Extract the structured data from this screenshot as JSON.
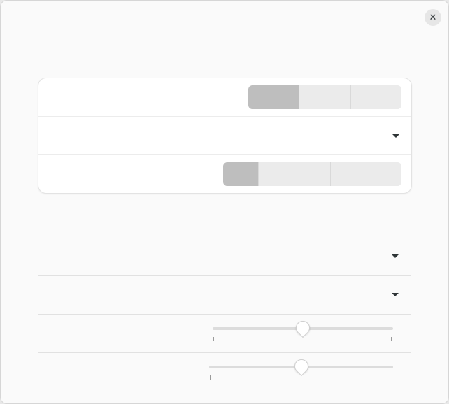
{
  "window": {
    "close_icon": "close-icon",
    "close_glyph": "✕"
  },
  "card": {
    "rows": [
      {
        "label": "",
        "control": "segmented",
        "segments": [
          "",
          "",
          ""
        ],
        "active": 0
      },
      {
        "label": "",
        "control": "dropdown",
        "value": ""
      },
      {
        "label": "",
        "control": "segmented",
        "segments": [
          "",
          "",
          "",
          "",
          ""
        ],
        "active": 0
      }
    ]
  },
  "list": {
    "rows": [
      {
        "label": "",
        "control": "dropdown",
        "value": ""
      },
      {
        "label": "",
        "control": "dropdown",
        "value": ""
      },
      {
        "label": "",
        "control": "slider",
        "value": 0.5
      },
      {
        "label": "",
        "control": "slider",
        "value": 0.5
      }
    ]
  },
  "colors": {
    "window_bg": "#fafafa",
    "card_bg": "#ffffff",
    "segment_active": "#bebebe",
    "segment_inactive": "#ebebeb",
    "text": "#2e3436"
  }
}
